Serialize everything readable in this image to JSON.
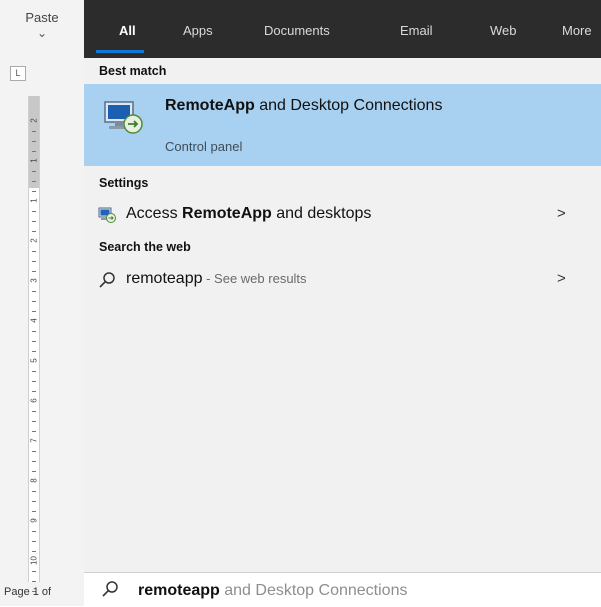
{
  "word": {
    "paste_label": "Paste",
    "paste_chevron": "⌄",
    "tab_stop_glyph": "L",
    "ruler_numbers": [
      "2",
      "1",
      "1",
      "2",
      "3",
      "4",
      "5",
      "6",
      "7",
      "8",
      "9",
      "10"
    ],
    "page_status": "Page 1 of"
  },
  "tabs": [
    {
      "label": "All",
      "active": true
    },
    {
      "label": "Apps",
      "active": false
    },
    {
      "label": "Documents",
      "active": false
    },
    {
      "label": "Email",
      "active": false
    },
    {
      "label": "Web",
      "active": false
    },
    {
      "label": "More",
      "active": false
    }
  ],
  "best_match": {
    "heading": "Best match",
    "title_bold": "RemoteApp",
    "title_rest": " and Desktop Connections",
    "subtitle": "Control panel",
    "icon": "remote-desktop-icon"
  },
  "settings": {
    "heading": "Settings",
    "item": {
      "pre": "Access ",
      "bold": "RemoteApp",
      "post": " and desktops",
      "icon": "remoteapp-settings-icon",
      "arrow": ">"
    }
  },
  "web": {
    "heading": "Search the web",
    "item": {
      "query": "remoteapp",
      "suffix": " - See web results",
      "icon": "search-icon",
      "arrow": ">"
    }
  },
  "searchbox": {
    "typed": "remoteapp",
    "completion": " and Desktop Connections",
    "icon": "search-icon"
  },
  "colors": {
    "tabbar_bg": "#2c2c2c",
    "accent": "#0e78d7",
    "selection_bg": "#a8d0f0",
    "panel_bg": "#f1f1f1"
  }
}
